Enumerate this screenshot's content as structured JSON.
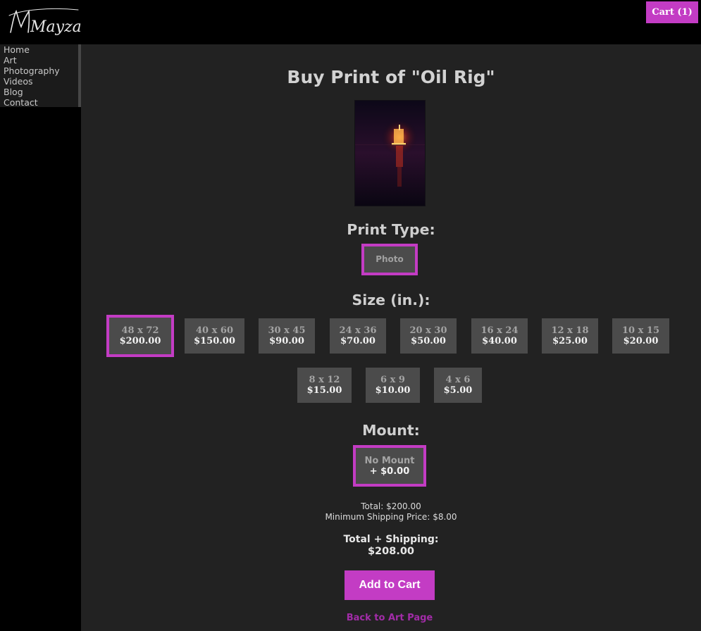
{
  "site": {
    "logo_text": "Mayzarl"
  },
  "header": {
    "cart_label": "Cart (1)"
  },
  "nav": {
    "items": [
      {
        "label": "Home"
      },
      {
        "label": "Art"
      },
      {
        "label": "Photography"
      },
      {
        "label": "Videos"
      },
      {
        "label": "Blog"
      },
      {
        "label": "Contact"
      }
    ]
  },
  "page": {
    "title": "Buy Print of \"Oil Rig\""
  },
  "print_type": {
    "heading": "Print Type:",
    "options": [
      {
        "label": "Photo",
        "selected": true
      }
    ]
  },
  "size": {
    "heading": "Size (in.):",
    "options": [
      {
        "dims": "48 x 72",
        "price": "$200.00",
        "selected": true
      },
      {
        "dims": "40 x 60",
        "price": "$150.00"
      },
      {
        "dims": "30 x 45",
        "price": "$90.00"
      },
      {
        "dims": "24 x 36",
        "price": "$70.00"
      },
      {
        "dims": "20 x 30",
        "price": "$50.00"
      },
      {
        "dims": "16 x 24",
        "price": "$40.00"
      },
      {
        "dims": "12 x 18",
        "price": "$25.00"
      },
      {
        "dims": "10 x 15",
        "price": "$20.00"
      },
      {
        "dims": "8 x 12",
        "price": "$15.00"
      },
      {
        "dims": "6 x 9",
        "price": "$10.00"
      },
      {
        "dims": "4 x 6",
        "price": "$5.00"
      }
    ]
  },
  "mount": {
    "heading": "Mount:",
    "options": [
      {
        "label": "No Mount",
        "price": "+ $0.00",
        "selected": true
      }
    ]
  },
  "summary": {
    "total_label": "Total:",
    "total_value": "$200.00",
    "shipping_label": "Minimum Shipping Price:",
    "shipping_value": "$8.00",
    "grand_label": "Total + Shipping:",
    "grand_value": "$208.00"
  },
  "actions": {
    "add_to_cart": "Add to Cart",
    "back_link": "Back to Art Page"
  },
  "colors": {
    "accent": "#c33cc4",
    "background": "#000000",
    "panel": "#222222",
    "option": "#4b4b4b",
    "link": "#a22ca8"
  }
}
